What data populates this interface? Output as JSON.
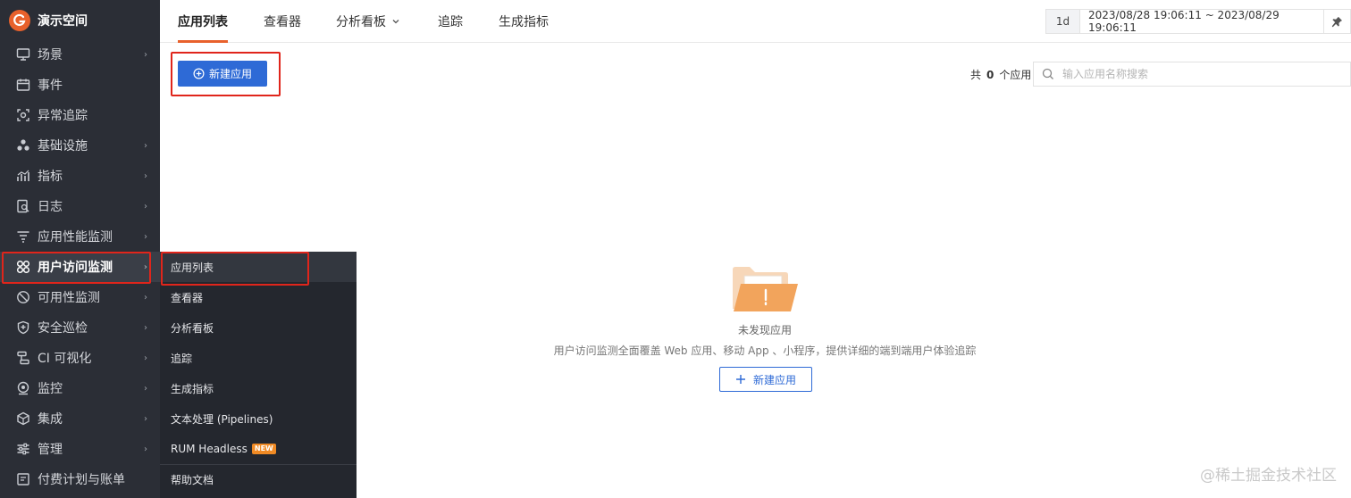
{
  "brand": {
    "name": "演示空间"
  },
  "sidebar": {
    "items": [
      {
        "label": "场景",
        "icon": "monitor-icon",
        "arrow": "›"
      },
      {
        "label": "事件",
        "icon": "calendar-icon",
        "arrow": ""
      },
      {
        "label": "异常追踪",
        "icon": "focus-icon",
        "arrow": ""
      },
      {
        "label": "基础设施",
        "icon": "cluster-icon",
        "arrow": "›"
      },
      {
        "label": "指标",
        "icon": "chart-icon",
        "arrow": "›"
      },
      {
        "label": "日志",
        "icon": "log-search-icon",
        "arrow": "›"
      },
      {
        "label": "应用性能监测",
        "icon": "list-filter-icon",
        "arrow": "›"
      },
      {
        "label": "用户访问监测",
        "icon": "apps-grid-icon",
        "arrow": "›"
      },
      {
        "label": "可用性监测",
        "icon": "dial-icon",
        "arrow": "›"
      },
      {
        "label": "安全巡检",
        "icon": "shield-icon",
        "arrow": "›"
      },
      {
        "label": "CI 可视化",
        "icon": "pipeline-icon",
        "arrow": "›"
      },
      {
        "label": "监控",
        "icon": "webcam-icon",
        "arrow": "›"
      },
      {
        "label": "集成",
        "icon": "box-icon",
        "arrow": "›"
      },
      {
        "label": "管理",
        "icon": "sliders-icon",
        "arrow": "›"
      },
      {
        "label": "付费计划与账单",
        "icon": "billing-icon",
        "arrow": ""
      }
    ]
  },
  "submenu": {
    "items": [
      {
        "label": "应用列表"
      },
      {
        "label": "查看器"
      },
      {
        "label": "分析看板"
      },
      {
        "label": "追踪"
      },
      {
        "label": "生成指标"
      },
      {
        "label": "文本处理 (Pipelines)"
      },
      {
        "label": "RUM Headless",
        "badge": "NEW"
      },
      {
        "label": "帮助文档"
      }
    ]
  },
  "tabs": [
    {
      "label": "应用列表"
    },
    {
      "label": "查看器"
    },
    {
      "label": "分析看板"
    },
    {
      "label": "追踪"
    },
    {
      "label": "生成指标"
    }
  ],
  "time": {
    "quick": "1d",
    "range": "2023/08/28 19:06:11 ~ 2023/08/29 19:06:11"
  },
  "toolbar": {
    "new_app_label": "新建应用"
  },
  "count": {
    "prefix": "共",
    "value": "0",
    "suffix": "个应用"
  },
  "search": {
    "placeholder": "输入应用名称搜索",
    "value": ""
  },
  "empty": {
    "title": "未发现应用",
    "description": "用户访问监测全面覆盖 Web 应用、移动 App 、小程序，提供详细的端到端用户体验追踪",
    "button_label": "新建应用"
  },
  "watermark": "@稀土掘金技术社区",
  "colors": {
    "accent": "#e8612c",
    "primary": "#2e6ad6",
    "highlight": "#e0251b",
    "sidebar_bg": "#2b2e36"
  }
}
